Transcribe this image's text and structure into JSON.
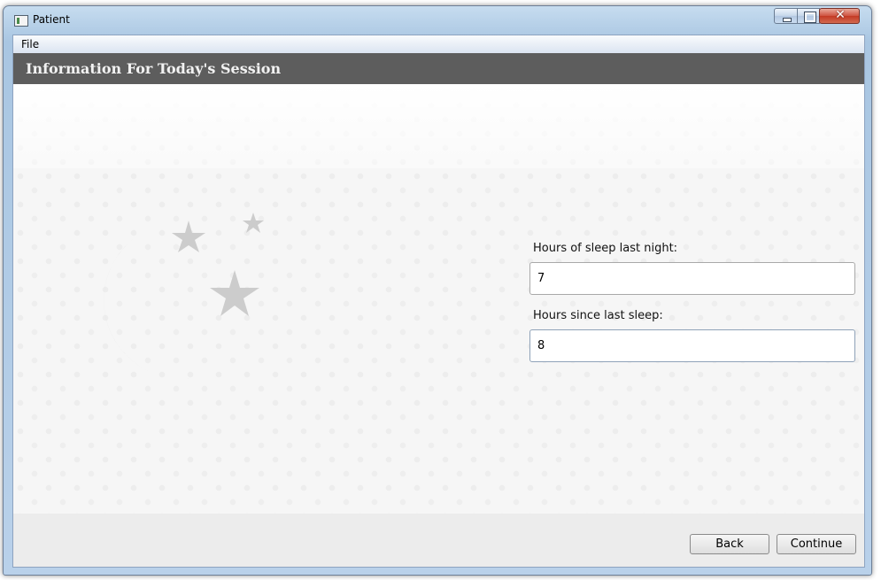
{
  "window": {
    "title": "Patient",
    "app_icon": "patient-app-icon",
    "close_glyph": "✕"
  },
  "menu": {
    "items": [
      {
        "label": "File"
      }
    ]
  },
  "header": {
    "title": "Information For Today's Session",
    "band_color": "#5d5d5d"
  },
  "illustration": {
    "icon": "moon-and-stars-icon",
    "color": "#cccccc"
  },
  "form": {
    "sleep_last_night": {
      "label": "Hours of sleep last night:",
      "value": "7"
    },
    "hours_since_sleep": {
      "label": "Hours since last sleep:",
      "value": "8"
    }
  },
  "footer": {
    "back_label": "Back",
    "continue_label": "Continue"
  }
}
